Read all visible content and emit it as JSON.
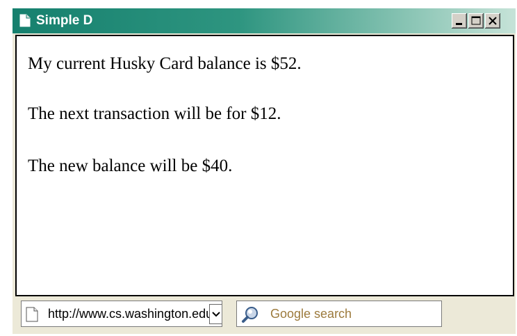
{
  "window": {
    "title": "Simple D"
  },
  "content": {
    "lines": [
      "My current Husky Card balance is $52.",
      "The next transaction will be for $12.",
      "The new balance will be $40."
    ]
  },
  "statusbar": {
    "url_value": "http://www.cs.washington.edu",
    "search_placeholder": "Google search"
  },
  "colors": {
    "titlebar_start": "#16806e",
    "titlebar_end": "#c6e3d8",
    "search_text": "#9c7a3c"
  }
}
